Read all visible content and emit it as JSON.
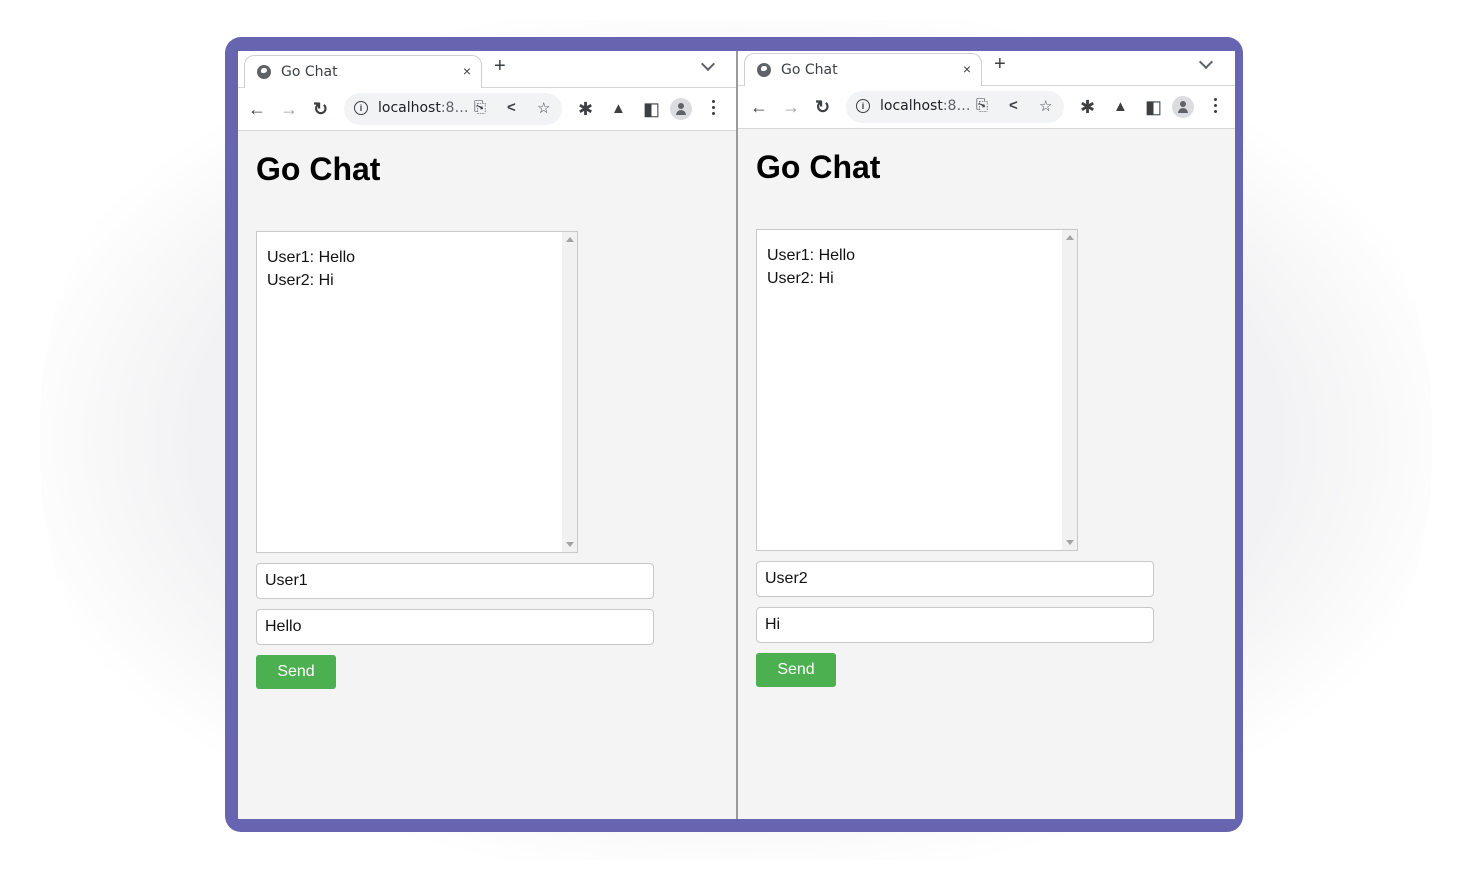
{
  "windows": [
    {
      "tab": {
        "title": "Go Chat",
        "close_glyph": "×",
        "new_tab_glyph": "+"
      },
      "toolbar": {
        "url_host": "localhost",
        "url_rest": ":8…"
      },
      "page": {
        "heading": "Go Chat",
        "messages": [
          "User1: Hello",
          "User2: Hi"
        ],
        "name_value": "User1",
        "message_value": "Hello",
        "send_label": "Send"
      }
    },
    {
      "tab": {
        "title": "Go Chat",
        "close_glyph": "×",
        "new_tab_glyph": "+"
      },
      "toolbar": {
        "url_host": "localhost",
        "url_rest": ":8…"
      },
      "page": {
        "heading": "Go Chat",
        "messages": [
          "User1: Hello",
          "User2: Hi"
        ],
        "name_value": "User2",
        "message_value": "Hi",
        "send_label": "Send"
      }
    }
  ],
  "icons": {
    "back": "←",
    "forward": "→",
    "reload": "↻",
    "info": "i",
    "translate": "⎘",
    "share": "<",
    "star": "☆",
    "extensions": "✱",
    "labs": "▲",
    "sidepanel": "◧"
  },
  "colors": {
    "frame": "#6764b0",
    "send_button": "#4caf50",
    "page_bg": "#f4f4f4"
  }
}
